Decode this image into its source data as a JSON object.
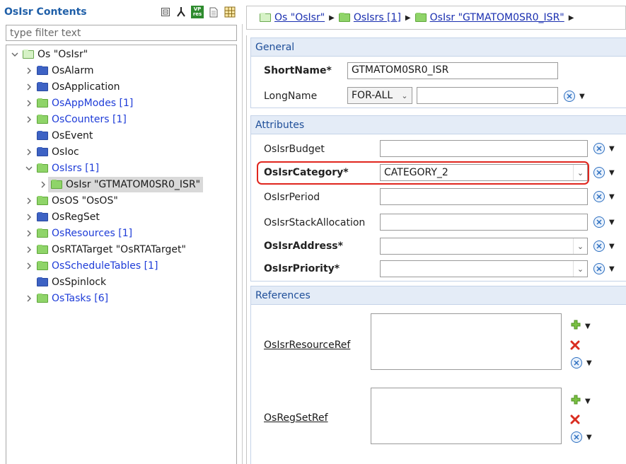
{
  "left_panel": {
    "title": "OsIsr Contents",
    "filter_placeholder": "type filter text",
    "tree": [
      {
        "label": "Os \"OsIsr\"",
        "color": "#1a1a1a",
        "icon": "folder-light-green-icon"
      },
      {
        "label": "OsAlarm",
        "color": "#1a1a1a",
        "icon": "folder-blue-icon"
      },
      {
        "label": "OsApplication",
        "color": "#1a1a1a",
        "icon": "folder-blue-icon"
      },
      {
        "label": "OsAppModes [1]",
        "color": "#1e3cd8",
        "icon": "folder-green-icon"
      },
      {
        "label": "OsCounters [1]",
        "color": "#1e3cd8",
        "icon": "folder-green-icon"
      },
      {
        "label": "OsEvent",
        "color": "#1a1a1a",
        "icon": "folder-blue-icon"
      },
      {
        "label": "OsIoc",
        "color": "#1a1a1a",
        "icon": "folder-blue-icon"
      },
      {
        "label": "OsIsrs [1]",
        "color": "#1e3cd8",
        "icon": "folder-green-icon"
      },
      {
        "label": "OsIsr \"GTMATOM0SR0_ISR\"",
        "color": "#1a1a1a",
        "icon": "folder-green-icon"
      },
      {
        "label": "OsOS \"OsOS\"",
        "color": "#1a1a1a",
        "icon": "folder-green-icon"
      },
      {
        "label": "OsRegSet",
        "color": "#1a1a1a",
        "icon": "folder-blue-icon"
      },
      {
        "label": "OsResources [1]",
        "color": "#1e3cd8",
        "icon": "folder-green-icon"
      },
      {
        "label": "OsRTATarget \"OsRTATarget\"",
        "color": "#1a1a1a",
        "icon": "folder-green-icon"
      },
      {
        "label": "OsScheduleTables [1]",
        "color": "#1e3cd8",
        "icon": "folder-green-icon"
      },
      {
        "label": "OsSpinlock",
        "color": "#1a1a1a",
        "icon": "folder-blue-icon"
      },
      {
        "label": "OsTasks [6]",
        "color": "#1e3cd8",
        "icon": "folder-green-icon"
      }
    ],
    "toolbar_vp_badge_top": "VP",
    "toolbar_vp_badge_bottom": "res"
  },
  "breadcrumb": [
    {
      "label": "Os \"OsIsr\""
    },
    {
      "label": "OsIsrs [1]"
    },
    {
      "label": "OsIsr \"GTMATOM0SR0_ISR\""
    }
  ],
  "general": {
    "header": "General",
    "shortname_label": "ShortName*",
    "shortname_value": "GTMATOM0SR0_ISR",
    "longname_label": "LongName",
    "longname_lang": "FOR-ALL",
    "longname_value": ""
  },
  "attributes": {
    "header": "Attributes",
    "budget_label": "OsIsrBudget",
    "budget_value": "",
    "category_label": "OsIsrCategory*",
    "category_value": "CATEGORY_2",
    "period_label": "OsIsrPeriod",
    "period_value": "",
    "stack_label": "OsIsrStackAllocation",
    "stack_value": "",
    "address_label": "OsIsrAddress*",
    "address_value": "",
    "priority_label": "OsIsrPriority*",
    "priority_value": ""
  },
  "references": {
    "header": "References",
    "resource_ref_label": "OsIsrResourceRef",
    "regset_ref_label": "OsRegSetRef"
  },
  "colors": {
    "highlight": "#e0261e",
    "section_header_bg": "#e4ecf7",
    "link_blue": "#1e3cd8"
  }
}
